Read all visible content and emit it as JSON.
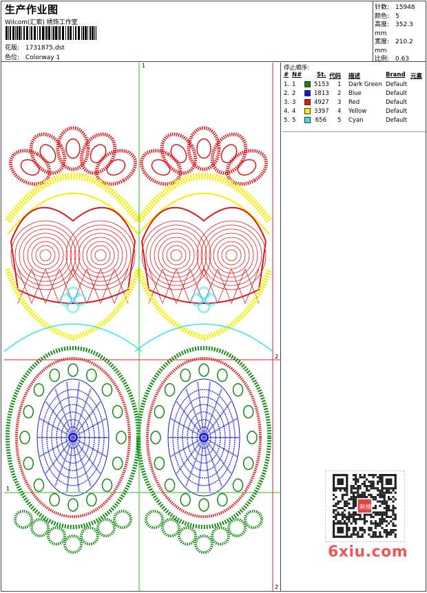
{
  "header": {
    "title": "生产作业图",
    "subtitle": "Wilcom(汇索) 绣饰工作室",
    "file_label": "花版:",
    "file_value": "1731875.dst",
    "colorway_label": "色位:",
    "colorway_value": "Colorway 1"
  },
  "stats": [
    {
      "label": "针数:",
      "value": "15948"
    },
    {
      "label": "颜色:",
      "value": "5"
    },
    {
      "label": "高度:",
      "value": "352.3 mm"
    },
    {
      "label": "宽度:",
      "value": "210.2 mm"
    },
    {
      "label": "比例:",
      "value": "0.63"
    }
  ],
  "stop_sequence": {
    "title": "停止顺序:",
    "columns": [
      "#",
      "N#",
      "St.",
      "代码",
      "描述",
      "Brand",
      "元素"
    ],
    "rows": [
      {
        "idx": "1.",
        "n": "1",
        "st": "5153",
        "code": "1",
        "desc": "Dark Green",
        "brand": "Default",
        "color": "#118a11"
      },
      {
        "idx": "2.",
        "n": "2",
        "st": "1813",
        "code": "2",
        "desc": "Blue",
        "brand": "Default",
        "color": "#1616d8"
      },
      {
        "idx": "3.",
        "n": "3",
        "st": "4927",
        "code": "3",
        "desc": "Red",
        "brand": "Default",
        "color": "#e01414"
      },
      {
        "idx": "4.",
        "n": "4",
        "st": "3397",
        "code": "4",
        "desc": "Yellow",
        "brand": "Default",
        "color": "#f5f000"
      },
      {
        "idx": "5.",
        "n": "5",
        "st": "656",
        "code": "5",
        "desc": "Cyan",
        "brand": "Default",
        "color": "#30e4f0"
      }
    ]
  },
  "guides": {
    "top_marker": "1",
    "right_marker": "2",
    "left_marker": "1",
    "bottom_marker": "2"
  },
  "watermark": {
    "site": "6xiu.com",
    "stamp_chars": [
      "刺",
      "绣"
    ]
  }
}
